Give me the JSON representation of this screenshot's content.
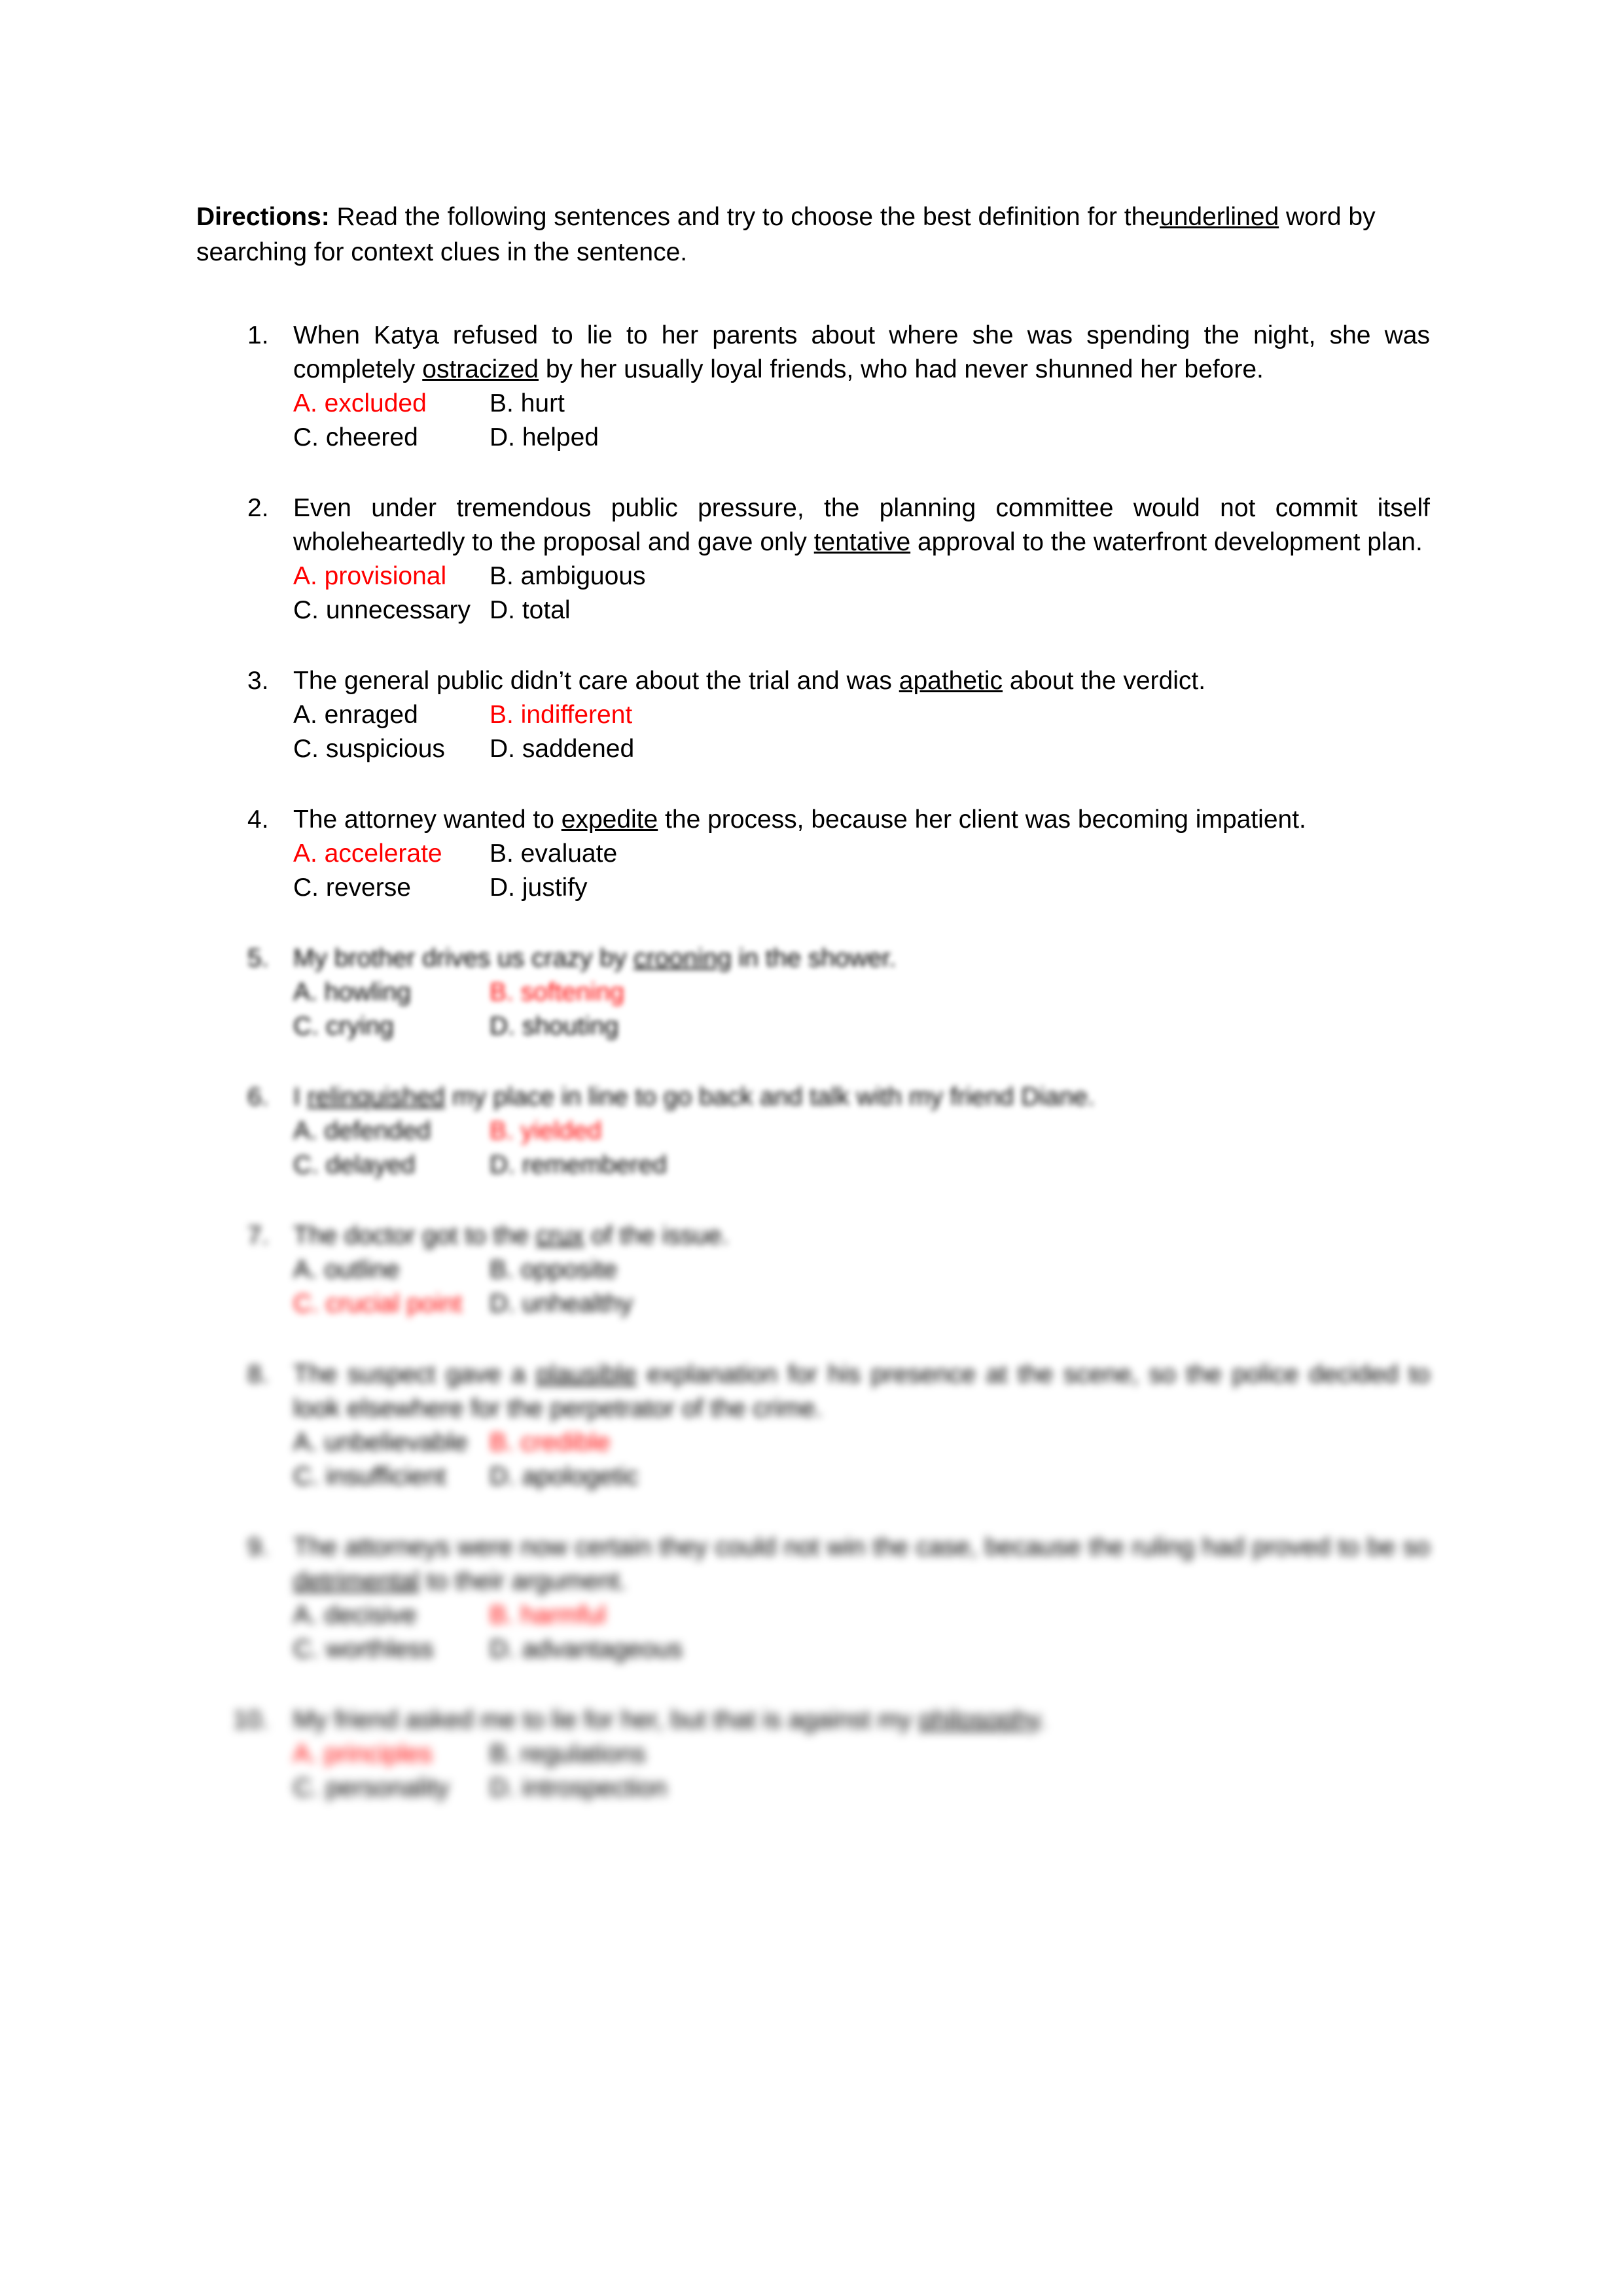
{
  "document": {
    "directions_label": "Directions:",
    "directions_body_1": " Read the following sentences and try to choose the best definition for the",
    "directions_underlined": "underlined",
    "directions_body_2": " word by searching for context clues in the sentence."
  },
  "questions": [
    {
      "number": "1.",
      "sentence_pre": "When Katya refused to lie to her parents about where she was spending the night, she was completely ",
      "sentence_underlined": "ostracized",
      "sentence_post": " by her usually loyal friends, who had never shunned her before.",
      "options": [
        {
          "label": "A. excluded",
          "correct": true
        },
        {
          "label": "B. hurt",
          "correct": false
        },
        {
          "label": "C. cheered",
          "correct": false
        },
        {
          "label": "D. helped",
          "correct": false
        }
      ],
      "blur": 0
    },
    {
      "number": "2.",
      "sentence_pre": "Even under tremendous public pressure, the planning committee would not commit itself wholeheartedly to the proposal and gave only ",
      "sentence_underlined": "tentative",
      "sentence_post": " approval to the waterfront  development plan.",
      "options": [
        {
          "label": "A. provisional",
          "correct": true
        },
        {
          "label": "B. ambiguous",
          "correct": false
        },
        {
          "label": "C. unnecessary",
          "correct": false
        },
        {
          "label": "D. total",
          "correct": false
        }
      ],
      "blur": 0
    },
    {
      "number": "3.",
      "sentence_pre": "The general public didn’t care about the trial and was ",
      "sentence_underlined": "apathetic",
      "sentence_post": " about the verdict.",
      "options": [
        {
          "label": "A. enraged",
          "correct": false
        },
        {
          "label": "B. indifferent",
          "correct": true
        },
        {
          "label": "C. suspicious",
          "correct": false
        },
        {
          "label": "D. saddened",
          "correct": false
        }
      ],
      "blur": 0
    },
    {
      "number": "4.",
      "sentence_pre": "The attorney wanted to ",
      "sentence_underlined": "expedite",
      "sentence_post": " the process, because her client was becoming impatient.",
      "options": [
        {
          "label": "A. accelerate",
          "correct": true
        },
        {
          "label": "B. evaluate",
          "correct": false
        },
        {
          "label": "C. reverse",
          "correct": false
        },
        {
          "label": "D. justify",
          "correct": false
        }
      ],
      "blur": 0
    },
    {
      "number": "5.",
      "sentence_pre": "My brother drives us crazy by ",
      "sentence_underlined": "crooning",
      "sentence_post": " in the shower.",
      "options": [
        {
          "label": "A. howling",
          "correct": false
        },
        {
          "label": "B. softening",
          "correct": true
        },
        {
          "label": "C. crying",
          "correct": false
        },
        {
          "label": "D. shouting",
          "correct": false
        }
      ],
      "blur": 2
    },
    {
      "number": "6.",
      "sentence_pre": "I ",
      "sentence_underlined": "relinquished",
      "sentence_post": " my place in line to go back and talk with my friend Diane.",
      "options": [
        {
          "label": "A. defended",
          "correct": false
        },
        {
          "label": "B. yielded",
          "correct": true
        },
        {
          "label": "C. delayed",
          "correct": false
        },
        {
          "label": "D. remembered",
          "correct": false
        }
      ],
      "blur": 3
    },
    {
      "number": "7.",
      "sentence_pre": "The doctor got to the ",
      "sentence_underlined": "crux",
      "sentence_post": " of the issue.",
      "options": [
        {
          "label": "A. outline",
          "correct": false
        },
        {
          "label": "B. opposite",
          "correct": false
        },
        {
          "label": "C. crucial point",
          "correct": true
        },
        {
          "label": "D. unhealthy",
          "correct": false
        }
      ],
      "blur": 4
    },
    {
      "number": "8.",
      "sentence_pre": "The suspect gave a ",
      "sentence_underlined": "plausible",
      "sentence_post": " explanation for his presence at the scene, so the police decided to look elsewhere for the perpetrator of the crime.",
      "options": [
        {
          "label": "A. unbelievable",
          "correct": false
        },
        {
          "label": "B. credible",
          "correct": true
        },
        {
          "label": "C. insufficient",
          "correct": false
        },
        {
          "label": "D. apologetic",
          "correct": false
        }
      ],
      "blur": 5
    },
    {
      "number": "9.",
      "sentence_pre": "The attorneys were now certain they could not win the case, because the ruling had proved to be so ",
      "sentence_underlined": "detrimental",
      "sentence_post": " to their argument.",
      "options": [
        {
          "label": "A. decisive",
          "correct": false
        },
        {
          "label": "B. harmful",
          "correct": true
        },
        {
          "label": "C. worthless",
          "correct": false
        },
        {
          "label": "D. advantageous",
          "correct": false
        }
      ],
      "blur": 6
    },
    {
      "number": "10.",
      "sentence_pre": "My friend asked me to lie for her, but that is against my ",
      "sentence_underlined": "philosophy",
      "sentence_post": ".",
      "options": [
        {
          "label": "A. principles",
          "correct": true
        },
        {
          "label": "B. regulations",
          "correct": false
        },
        {
          "label": "C. personality",
          "correct": false
        },
        {
          "label": "D. introspection",
          "correct": false
        }
      ],
      "blur": 7
    }
  ]
}
